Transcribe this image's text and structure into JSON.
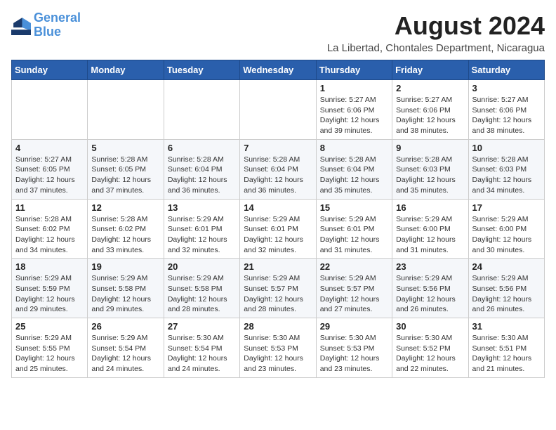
{
  "logo": {
    "text_general": "General",
    "text_blue": "Blue"
  },
  "title": "August 2024",
  "subtitle": "La Libertad, Chontales Department, Nicaragua",
  "days_header": [
    "Sunday",
    "Monday",
    "Tuesday",
    "Wednesday",
    "Thursday",
    "Friday",
    "Saturday"
  ],
  "weeks": [
    [
      {
        "day": "",
        "info": ""
      },
      {
        "day": "",
        "info": ""
      },
      {
        "day": "",
        "info": ""
      },
      {
        "day": "",
        "info": ""
      },
      {
        "day": "1",
        "info": "Sunrise: 5:27 AM\nSunset: 6:06 PM\nDaylight: 12 hours\nand 39 minutes."
      },
      {
        "day": "2",
        "info": "Sunrise: 5:27 AM\nSunset: 6:06 PM\nDaylight: 12 hours\nand 38 minutes."
      },
      {
        "day": "3",
        "info": "Sunrise: 5:27 AM\nSunset: 6:06 PM\nDaylight: 12 hours\nand 38 minutes."
      }
    ],
    [
      {
        "day": "4",
        "info": "Sunrise: 5:27 AM\nSunset: 6:05 PM\nDaylight: 12 hours\nand 37 minutes."
      },
      {
        "day": "5",
        "info": "Sunrise: 5:28 AM\nSunset: 6:05 PM\nDaylight: 12 hours\nand 37 minutes."
      },
      {
        "day": "6",
        "info": "Sunrise: 5:28 AM\nSunset: 6:04 PM\nDaylight: 12 hours\nand 36 minutes."
      },
      {
        "day": "7",
        "info": "Sunrise: 5:28 AM\nSunset: 6:04 PM\nDaylight: 12 hours\nand 36 minutes."
      },
      {
        "day": "8",
        "info": "Sunrise: 5:28 AM\nSunset: 6:04 PM\nDaylight: 12 hours\nand 35 minutes."
      },
      {
        "day": "9",
        "info": "Sunrise: 5:28 AM\nSunset: 6:03 PM\nDaylight: 12 hours\nand 35 minutes."
      },
      {
        "day": "10",
        "info": "Sunrise: 5:28 AM\nSunset: 6:03 PM\nDaylight: 12 hours\nand 34 minutes."
      }
    ],
    [
      {
        "day": "11",
        "info": "Sunrise: 5:28 AM\nSunset: 6:02 PM\nDaylight: 12 hours\nand 34 minutes."
      },
      {
        "day": "12",
        "info": "Sunrise: 5:28 AM\nSunset: 6:02 PM\nDaylight: 12 hours\nand 33 minutes."
      },
      {
        "day": "13",
        "info": "Sunrise: 5:29 AM\nSunset: 6:01 PM\nDaylight: 12 hours\nand 32 minutes."
      },
      {
        "day": "14",
        "info": "Sunrise: 5:29 AM\nSunset: 6:01 PM\nDaylight: 12 hours\nand 32 minutes."
      },
      {
        "day": "15",
        "info": "Sunrise: 5:29 AM\nSunset: 6:01 PM\nDaylight: 12 hours\nand 31 minutes."
      },
      {
        "day": "16",
        "info": "Sunrise: 5:29 AM\nSunset: 6:00 PM\nDaylight: 12 hours\nand 31 minutes."
      },
      {
        "day": "17",
        "info": "Sunrise: 5:29 AM\nSunset: 6:00 PM\nDaylight: 12 hours\nand 30 minutes."
      }
    ],
    [
      {
        "day": "18",
        "info": "Sunrise: 5:29 AM\nSunset: 5:59 PM\nDaylight: 12 hours\nand 29 minutes."
      },
      {
        "day": "19",
        "info": "Sunrise: 5:29 AM\nSunset: 5:58 PM\nDaylight: 12 hours\nand 29 minutes."
      },
      {
        "day": "20",
        "info": "Sunrise: 5:29 AM\nSunset: 5:58 PM\nDaylight: 12 hours\nand 28 minutes."
      },
      {
        "day": "21",
        "info": "Sunrise: 5:29 AM\nSunset: 5:57 PM\nDaylight: 12 hours\nand 28 minutes."
      },
      {
        "day": "22",
        "info": "Sunrise: 5:29 AM\nSunset: 5:57 PM\nDaylight: 12 hours\nand 27 minutes."
      },
      {
        "day": "23",
        "info": "Sunrise: 5:29 AM\nSunset: 5:56 PM\nDaylight: 12 hours\nand 26 minutes."
      },
      {
        "day": "24",
        "info": "Sunrise: 5:29 AM\nSunset: 5:56 PM\nDaylight: 12 hours\nand 26 minutes."
      }
    ],
    [
      {
        "day": "25",
        "info": "Sunrise: 5:29 AM\nSunset: 5:55 PM\nDaylight: 12 hours\nand 25 minutes."
      },
      {
        "day": "26",
        "info": "Sunrise: 5:29 AM\nSunset: 5:54 PM\nDaylight: 12 hours\nand 24 minutes."
      },
      {
        "day": "27",
        "info": "Sunrise: 5:30 AM\nSunset: 5:54 PM\nDaylight: 12 hours\nand 24 minutes."
      },
      {
        "day": "28",
        "info": "Sunrise: 5:30 AM\nSunset: 5:53 PM\nDaylight: 12 hours\nand 23 minutes."
      },
      {
        "day": "29",
        "info": "Sunrise: 5:30 AM\nSunset: 5:53 PM\nDaylight: 12 hours\nand 23 minutes."
      },
      {
        "day": "30",
        "info": "Sunrise: 5:30 AM\nSunset: 5:52 PM\nDaylight: 12 hours\nand 22 minutes."
      },
      {
        "day": "31",
        "info": "Sunrise: 5:30 AM\nSunset: 5:51 PM\nDaylight: 12 hours\nand 21 minutes."
      }
    ]
  ]
}
